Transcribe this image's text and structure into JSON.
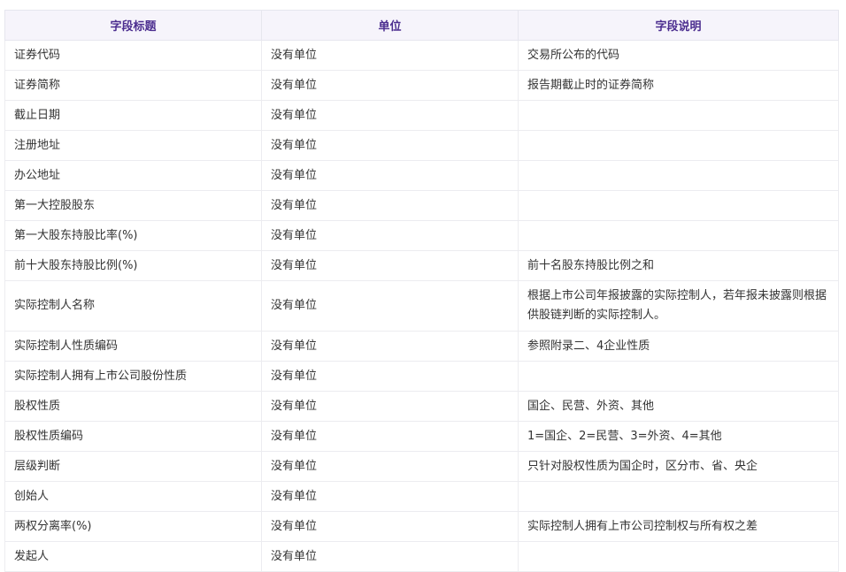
{
  "table": {
    "headers": [
      "字段标题",
      "单位",
      "字段说明"
    ],
    "rows": [
      [
        "证券代码",
        "没有单位",
        "交易所公布的代码"
      ],
      [
        "证券简称",
        "没有单位",
        "报告期截止时的证券简称"
      ],
      [
        "截止日期",
        "没有单位",
        ""
      ],
      [
        "注册地址",
        "没有单位",
        ""
      ],
      [
        "办公地址",
        "没有单位",
        ""
      ],
      [
        "第一大控股股东",
        "没有单位",
        ""
      ],
      [
        "第一大股东持股比率(%)",
        "没有单位",
        ""
      ],
      [
        "前十大股东持股比例(%)",
        "没有单位",
        "前十名股东持股比例之和"
      ],
      [
        "实际控制人名称",
        "没有单位",
        "根据上市公司年报披露的实际控制人，若年报未披露则根据供股链判断的实际控制人。"
      ],
      [
        "实际控制人性质编码",
        "没有单位",
        "参照附录二、4企业性质"
      ],
      [
        "实际控制人拥有上市公司股份性质",
        "没有单位",
        ""
      ],
      [
        "股权性质",
        "没有单位",
        "国企、民营、外资、其他"
      ],
      [
        "股权性质编码",
        "没有单位",
        "1=国企、2=民营、3=外资、4=其他"
      ],
      [
        "层级判断",
        "没有单位",
        "只针对股权性质为国企时，区分市、省、央企"
      ],
      [
        "创始人",
        "没有单位",
        ""
      ],
      [
        "两权分离率(%)",
        "没有单位",
        "实际控制人拥有上市公司控制权与所有权之差"
      ],
      [
        "发起人",
        "没有单位",
        ""
      ]
    ]
  }
}
